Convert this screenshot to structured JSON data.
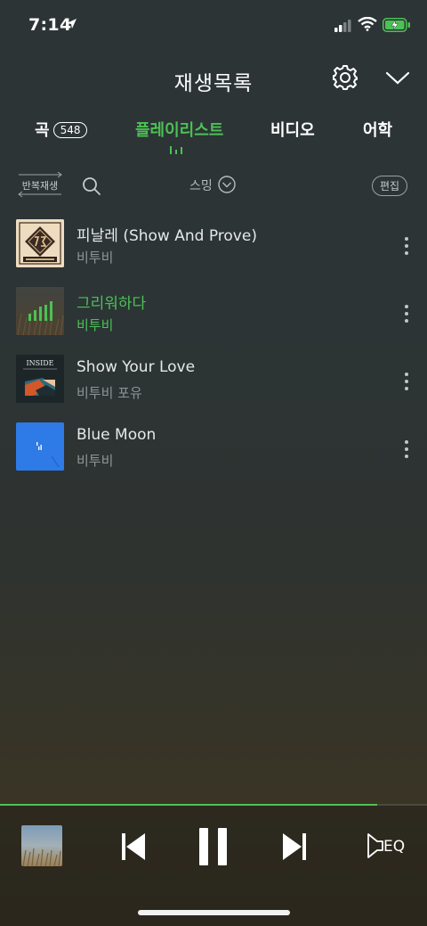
{
  "status_bar": {
    "time": "7:14"
  },
  "header": {
    "title": "재생목록"
  },
  "tabs": [
    {
      "label": "곡",
      "count": "548"
    },
    {
      "label": "플레이리스트"
    },
    {
      "label": "비디오"
    },
    {
      "label": "어학"
    }
  ],
  "toolbar": {
    "repeat_label": "반복재생",
    "sort_label": "스밍",
    "edit_label": "편집"
  },
  "songs": [
    {
      "title": "피날레 (Show And Prove)",
      "artist": "비투비"
    },
    {
      "title": "그리워하다",
      "artist": "비투비"
    },
    {
      "title": "Show Your Love",
      "artist": "비투비 포유"
    },
    {
      "title": "Blue Moon",
      "artist": "비투비"
    }
  ],
  "album_art_text": {
    "inside": "INSIDE"
  },
  "player": {
    "eq_label": "EQ",
    "progress": 0.883
  },
  "colors": {
    "accent": "#4cc154",
    "text": "#ffffff",
    "muted": "#8f9597"
  }
}
